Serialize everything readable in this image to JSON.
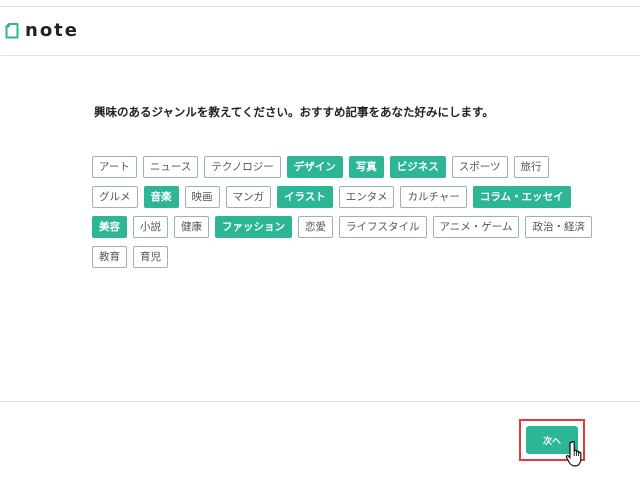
{
  "header": {
    "logo_text": "note"
  },
  "prompt": "興味のあるジャンルを教えてください。おすすめ記事をあなた好みにします。",
  "tag_rows": [
    [
      {
        "label": "アート",
        "selected": false
      },
      {
        "label": "ニュース",
        "selected": false
      },
      {
        "label": "テクノロジー",
        "selected": false
      },
      {
        "label": "デザイン",
        "selected": true
      },
      {
        "label": "写真",
        "selected": true
      },
      {
        "label": "ビジネス",
        "selected": true
      },
      {
        "label": "スポーツ",
        "selected": false
      },
      {
        "label": "旅行",
        "selected": false
      }
    ],
    [
      {
        "label": "グルメ",
        "selected": false
      },
      {
        "label": "音楽",
        "selected": true
      },
      {
        "label": "映画",
        "selected": false
      },
      {
        "label": "マンガ",
        "selected": false
      },
      {
        "label": "イラスト",
        "selected": true
      },
      {
        "label": "エンタメ",
        "selected": false
      },
      {
        "label": "カルチャー",
        "selected": false
      },
      {
        "label": "コラム・エッセイ",
        "selected": true
      }
    ],
    [
      {
        "label": "美容",
        "selected": true
      },
      {
        "label": "小説",
        "selected": false
      },
      {
        "label": "健康",
        "selected": false
      },
      {
        "label": "ファッション",
        "selected": true
      },
      {
        "label": "恋愛",
        "selected": false
      },
      {
        "label": "ライフスタイル",
        "selected": false
      },
      {
        "label": "アニメ・ゲーム",
        "selected": false
      },
      {
        "label": "政治・経済",
        "selected": false
      }
    ],
    [
      {
        "label": "教育",
        "selected": false
      },
      {
        "label": "育児",
        "selected": false
      }
    ]
  ],
  "footer": {
    "next_label": "次へ"
  },
  "colors": {
    "accent": "#2cb696",
    "tag_border": "#9bb5ad",
    "highlight_box": "#e03a3a"
  },
  "icons": {
    "logo": "note-logo-icon",
    "cursor": "hand-pointer-icon"
  }
}
